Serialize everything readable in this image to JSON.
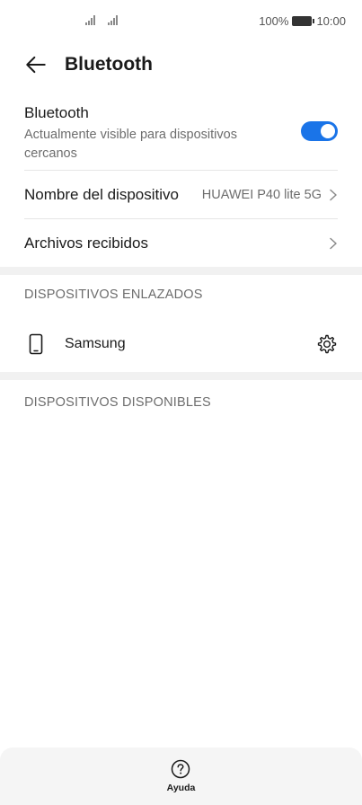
{
  "status_bar": {
    "battery": "100%",
    "time": "10:00",
    "icons": [
      "signal-icon",
      "signal-icon",
      "battery-icon"
    ]
  },
  "header": {
    "title": "Bluetooth",
    "back_icon": "arrow-left-icon"
  },
  "bluetooth": {
    "label": "Bluetooth",
    "subtitle": "Actualmente visible para dispositivos cercanos",
    "enabled": true,
    "accent_color": "#1a74e8"
  },
  "device_name": {
    "label": "Nombre del dispositivo",
    "value": "HUAWEI P40 lite 5G"
  },
  "received_files": {
    "label": "Archivos recibidos"
  },
  "paired": {
    "header": "DISPOSITIVOS ENLAZADOS",
    "devices": [
      {
        "name": "Samsung",
        "icon": "phone-icon",
        "action_icon": "gear-icon"
      }
    ]
  },
  "available": {
    "header": "DISPOSITIVOS DISPONIBLES"
  },
  "bottom_bar": {
    "help_label": "Ayuda",
    "help_icon": "help-circle-icon"
  }
}
